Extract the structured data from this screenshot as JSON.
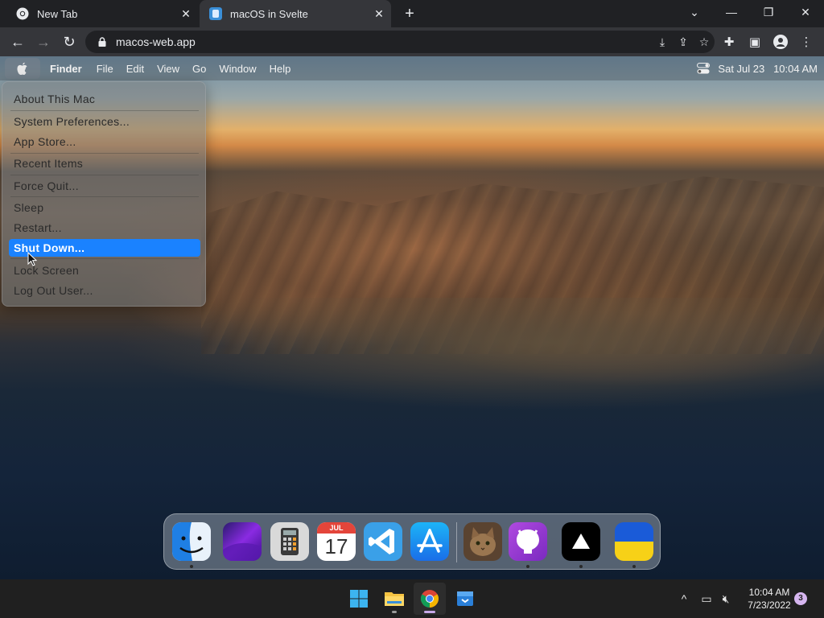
{
  "browser": {
    "tabs": [
      {
        "title": "New Tab",
        "icon": "chrome-icon",
        "active": false
      },
      {
        "title": "macOS in Svelte",
        "icon": "svelte-favicon-icon",
        "active": true
      }
    ],
    "new_tab_icon": "plus-icon",
    "url": "macos-web.app",
    "window_controls": [
      "chevron-down-icon",
      "minimize-icon",
      "restore-icon",
      "close-icon"
    ]
  },
  "menubar": {
    "app_name": "Finder",
    "items": [
      "File",
      "Edit",
      "View",
      "Go",
      "Window",
      "Help"
    ],
    "datetime": "Sat Jul 23   10:04 AM"
  },
  "apple_menu": {
    "items": [
      {
        "label": "About This Mac"
      },
      {
        "label": "System Preferences..."
      },
      {
        "label": "App Store..."
      },
      {
        "label": "Recent Items"
      },
      {
        "label": "Force Quit..."
      },
      {
        "label": "Sleep"
      },
      {
        "label": "Restart..."
      },
      {
        "label": "Shut Down...",
        "selected": true
      },
      {
        "label": "Lock Screen"
      },
      {
        "label": "Log Out User..."
      }
    ]
  },
  "dock": {
    "apps": [
      {
        "name": "finder-icon",
        "running": true
      },
      {
        "name": "wallpapers-icon",
        "running": false
      },
      {
        "name": "calculator-icon",
        "running": false
      },
      {
        "name": "calendar-icon",
        "running": false,
        "month": "JUL",
        "day": "17"
      },
      {
        "name": "vscode-icon",
        "running": false
      },
      {
        "name": "app-store-icon",
        "running": false
      },
      {
        "name": "cat-photo-icon",
        "running": false
      },
      {
        "name": "github-icon",
        "running": true
      },
      {
        "name": "vercel-icon",
        "running": true
      },
      {
        "name": "ukraine-flag-icon",
        "running": true
      }
    ]
  },
  "taskbar": {
    "apps": [
      "windows-start-icon",
      "file-explorer-icon",
      "chrome-icon",
      "package-icon"
    ],
    "time": "10:04 AM",
    "date": "7/23/2022",
    "notification_count": "3"
  },
  "colors": {
    "selection": "#1a82ff",
    "chrome_dark": "#202124",
    "chrome_toolbar": "#35363a",
    "taskbar": "#202020"
  }
}
